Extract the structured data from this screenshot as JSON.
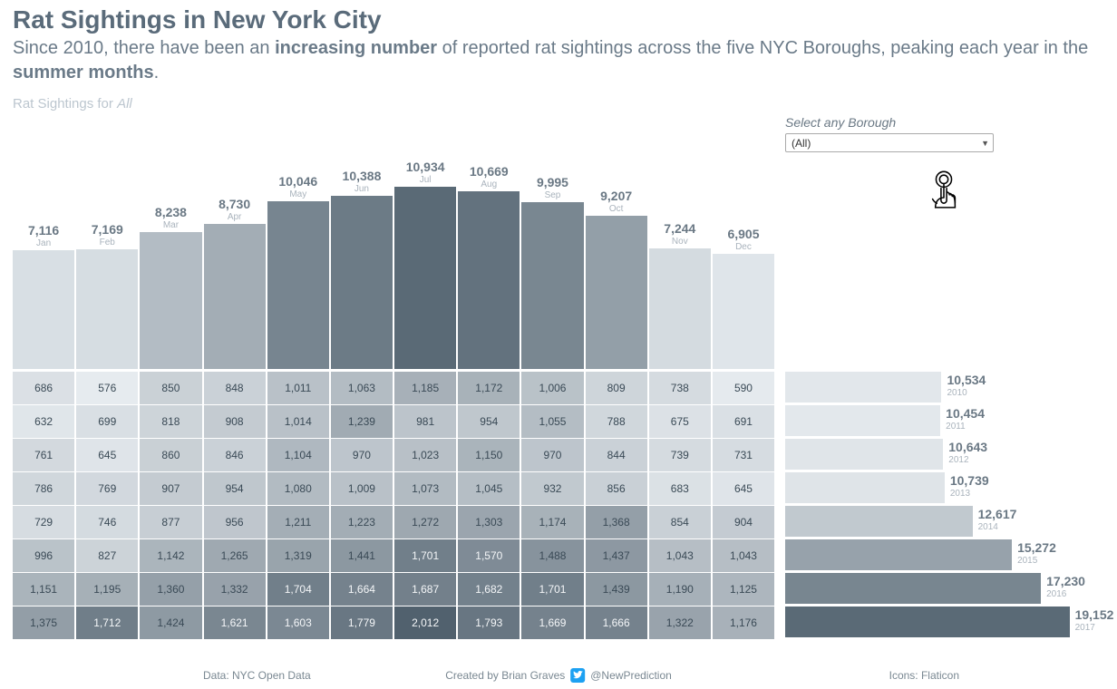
{
  "title": "Rat Sightings in New York City",
  "subtitle_parts": {
    "p1": "Since 2010, there have been an ",
    "b1": "increasing number",
    "p2": " of reported rat sightings across the five NYC Boroughs, peaking each year in the ",
    "b2": "summer months",
    "p3": "."
  },
  "chart_title_prefix": "Rat Sightings for ",
  "chart_title_filter": "All",
  "filter": {
    "label": "Select any Borough",
    "selected": "(All)"
  },
  "footer": {
    "data_source": "Data: NYC Open Data",
    "author": "Created by Brian Graves",
    "twitter": "@NewPrediction",
    "icons": "Icons: Flaticon"
  },
  "chart_data": {
    "type": "heatmap",
    "title": "Rat Sightings in New York City",
    "months": [
      "Jan",
      "Feb",
      "Mar",
      "Apr",
      "May",
      "Jun",
      "Jul",
      "Aug",
      "Sep",
      "Oct",
      "Nov",
      "Dec"
    ],
    "month_totals": [
      7116,
      7169,
      8238,
      8730,
      10046,
      10388,
      10934,
      10669,
      9995,
      9207,
      7244,
      6905
    ],
    "years": [
      2010,
      2011,
      2012,
      2013,
      2014,
      2015,
      2016,
      2017
    ],
    "year_totals": [
      10534,
      10454,
      10643,
      10739,
      12617,
      15272,
      17230,
      19152
    ],
    "matrix": [
      [
        686,
        576,
        850,
        848,
        1011,
        1063,
        1185,
        1172,
        1006,
        809,
        738,
        590
      ],
      [
        632,
        699,
        818,
        908,
        1014,
        1239,
        981,
        954,
        1055,
        788,
        675,
        691
      ],
      [
        761,
        645,
        860,
        846,
        1104,
        970,
        1023,
        1150,
        970,
        844,
        739,
        731
      ],
      [
        786,
        769,
        907,
        954,
        1080,
        1009,
        1073,
        1045,
        932,
        856,
        683,
        645
      ],
      [
        729,
        746,
        877,
        956,
        1211,
        1223,
        1272,
        1303,
        1174,
        1368,
        854,
        904
      ],
      [
        996,
        827,
        1142,
        1265,
        1319,
        1441,
        1701,
        1570,
        1488,
        1437,
        1043,
        1043
      ],
      [
        1151,
        1195,
        1360,
        1332,
        1704,
        1664,
        1687,
        1682,
        1701,
        1439,
        1190,
        1125
      ],
      [
        1375,
        1712,
        1424,
        1621,
        1603,
        1779,
        2012,
        1793,
        1669,
        1666,
        1322,
        1176
      ]
    ],
    "color_scale": {
      "min": 576,
      "max": 2012,
      "min_color": "#e6ebef",
      "max_color": "#51616e"
    }
  }
}
